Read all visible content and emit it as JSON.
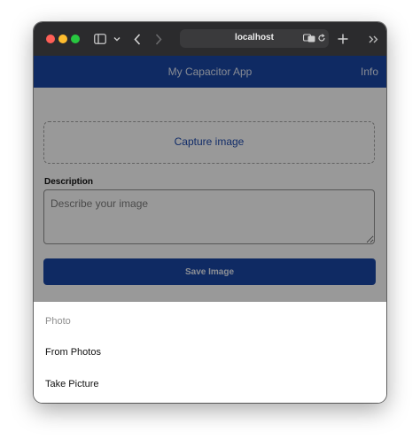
{
  "browser": {
    "url": "localhost",
    "colors": {
      "toolbar": "#2b2b2d",
      "close": "#ff5f57",
      "minimize": "#febc2e",
      "zoom": "#28c840"
    },
    "icons": [
      "sidebar-icon",
      "chevron-down-icon",
      "back-icon",
      "forward-icon",
      "translate-icon",
      "reload-icon",
      "new-tab-icon",
      "overflow-icon"
    ]
  },
  "app": {
    "title": "My Capacitor App",
    "info_label": "Info",
    "brand_color": "#1a47a6"
  },
  "form": {
    "capture_label": "Capture image",
    "description_label": "Description",
    "description_placeholder": "Describe your image",
    "description_value": "",
    "save_label": "Save Image"
  },
  "action_sheet": {
    "header": "Photo",
    "items": [
      {
        "label": "From Photos"
      },
      {
        "label": "Take Picture"
      }
    ]
  }
}
